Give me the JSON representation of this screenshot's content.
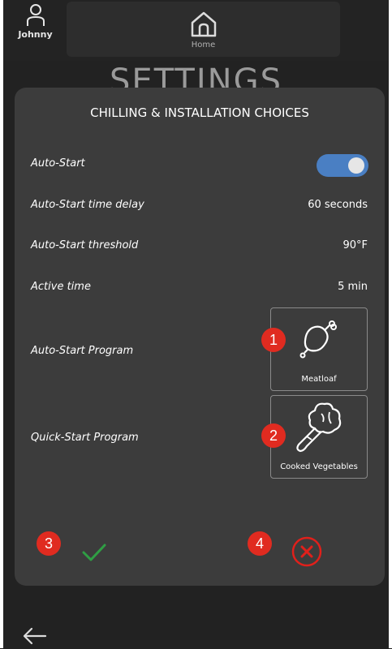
{
  "header": {
    "user_name": "Johnny",
    "home_label": "Home",
    "page_title": "SETTINGS"
  },
  "modal": {
    "title": "CHILLING & INSTALLATION CHOICES",
    "rows": [
      {
        "label": "Auto-Start",
        "toggle_on": true
      },
      {
        "label": "Auto-Start time delay",
        "value": "60 seconds"
      },
      {
        "label": "Auto-Start threshold",
        "value": "90°F"
      },
      {
        "label": "Active time",
        "value": "5 min"
      },
      {
        "label": "Auto-Start Program",
        "program": "Meatloaf",
        "icon": "meatloaf-icon"
      },
      {
        "label": "Quick-Start Program",
        "program": "Cooked Vegetables",
        "icon": "broccoli-icon"
      }
    ],
    "markers": [
      "1",
      "2",
      "3",
      "4"
    ]
  },
  "colors": {
    "accent": "#4a7fc3",
    "confirm": "#2f9e44",
    "cancel": "#e0201b",
    "marker": "#e02b20"
  }
}
